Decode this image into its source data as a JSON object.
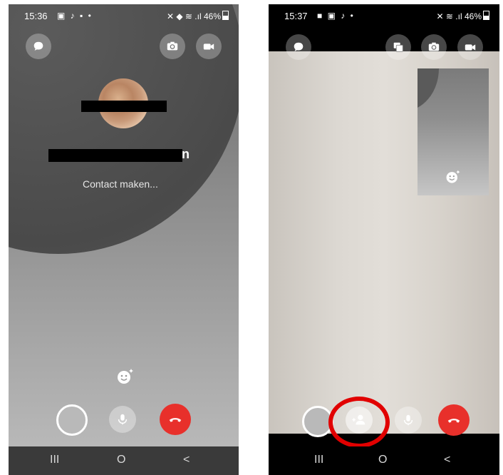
{
  "phone1": {
    "status": {
      "time": "15:36",
      "battery": "46%"
    },
    "call_status": "Contact maken...",
    "caller_name_visible": "n"
  },
  "phone2": {
    "status": {
      "time": "15:37",
      "battery": "46%"
    }
  },
  "nav": {
    "recents": "III",
    "home": "O",
    "back": "<"
  },
  "colors": {
    "end_call": "#e8302b",
    "highlight": "#e10000"
  }
}
